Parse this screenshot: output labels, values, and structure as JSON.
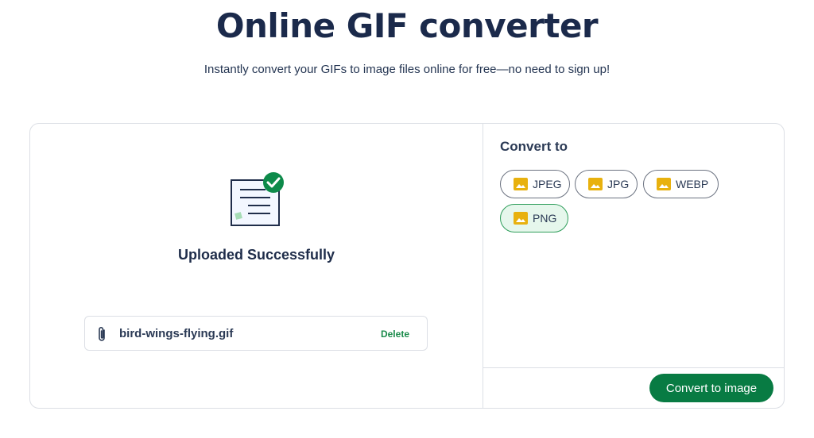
{
  "header": {
    "title": "Online GIF converter",
    "subtitle": "Instantly convert your GIFs to image files online for free—no need to sign up!"
  },
  "upload": {
    "status": "Uploaded Successfully",
    "illustration_icon": "document-check-icon",
    "file": {
      "icon": "paperclip-icon",
      "name": "bird-wings-flying.gif",
      "delete_label": "Delete"
    }
  },
  "convert": {
    "heading": "Convert to",
    "format_icon": "image-icon",
    "formats": [
      {
        "label": "JPEG",
        "selected": false
      },
      {
        "label": "JPG",
        "selected": false
      },
      {
        "label": "WEBP",
        "selected": false
      },
      {
        "label": "PNG",
        "selected": true
      }
    ],
    "button_label": "Convert to image"
  },
  "colors": {
    "primary_green": "#087b43",
    "link_green": "#1a8a4a",
    "selected_bg": "#e6f7ec",
    "icon_yellow": "#e8b10e",
    "title_navy": "#1b2a4b"
  }
}
